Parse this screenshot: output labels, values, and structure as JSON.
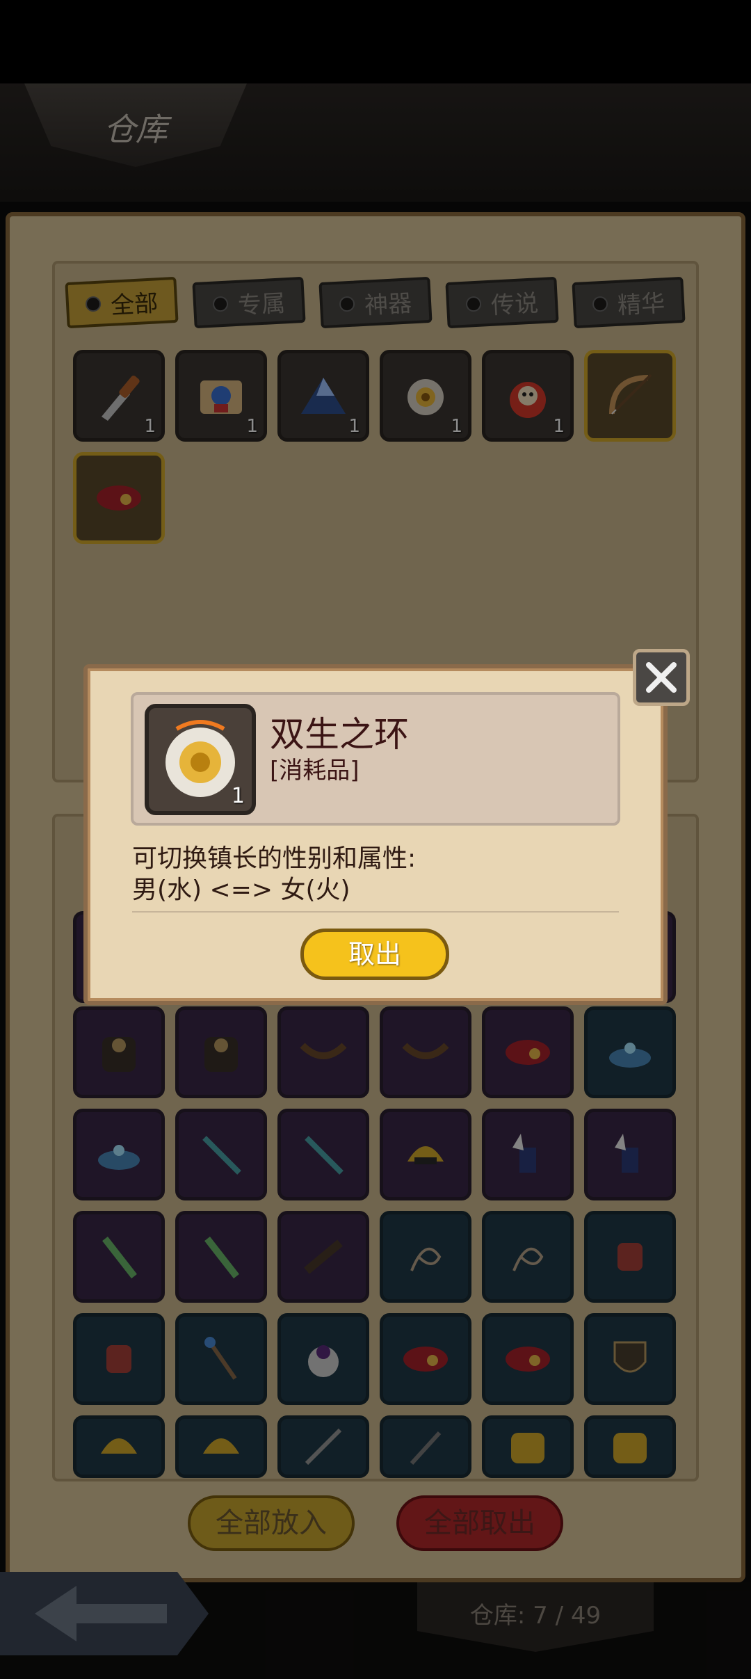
{
  "header": {
    "title": "仓库"
  },
  "tabs": [
    {
      "label": "全部",
      "active": true
    },
    {
      "label": "专属",
      "active": false
    },
    {
      "label": "神器",
      "active": false
    },
    {
      "label": "传说",
      "active": false
    },
    {
      "label": "精华",
      "active": false
    }
  ],
  "storage_items": [
    {
      "icon": "knife-icon",
      "count": "1"
    },
    {
      "icon": "scroll-icon",
      "count": "1"
    },
    {
      "icon": "crystal-pile-icon",
      "count": "1"
    },
    {
      "icon": "ring-icon",
      "count": "1"
    },
    {
      "icon": "clown-bag-icon",
      "count": "1"
    },
    {
      "icon": "bow-icon",
      "count": ""
    },
    {
      "icon": "belt-icon",
      "count": ""
    }
  ],
  "inventory_rows": [
    [
      "armor-icon",
      "armor-icon",
      "fang-necklace-icon",
      "fang-necklace-icon",
      "belt-icon",
      "crown-icon"
    ],
    [
      "crown-icon",
      "feather-sword-icon",
      "feather-sword-icon",
      "helmet-icon",
      "winged-boots-icon",
      "winged-boots-icon"
    ],
    [
      "green-sword-icon",
      "green-sword-icon",
      "spyglass-icon",
      "whip-icon",
      "whip-icon",
      "claw-glove-icon"
    ],
    [
      "claw-glove-icon",
      "staff-icon",
      "skull-ring-icon",
      "belt-icon",
      "belt-icon",
      "shield-icon"
    ],
    [
      "helmet-icon",
      "helmet-icon",
      "sword-icon",
      "dagger-icon",
      "bag-icon",
      "bag-icon"
    ]
  ],
  "buttons": {
    "put_all": "全部放入",
    "take_all": "全部取出"
  },
  "footer": {
    "capacity": "仓库: 7 / 49"
  },
  "modal": {
    "item_name": "双生之环",
    "item_type": "[消耗品]",
    "item_count": "1",
    "description_line1": "可切换镇长的性别和属性:",
    "description_line2": "男(水) <=> 女(火)",
    "withdraw_label": "取出"
  }
}
